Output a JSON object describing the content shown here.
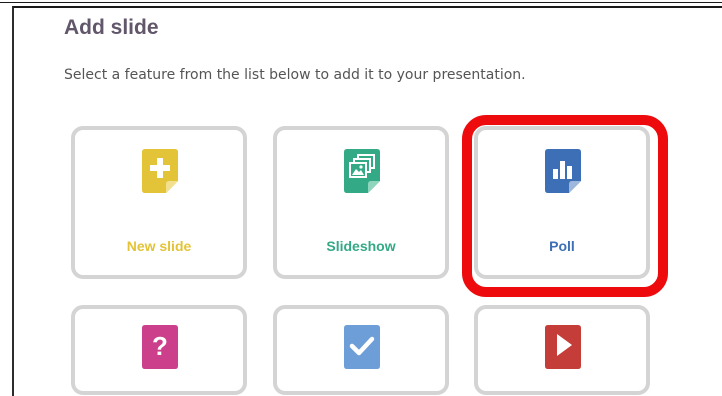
{
  "header": {
    "title": "Add slide",
    "subtitle": "Select a feature from the list below to add it to your presentation."
  },
  "features": [
    {
      "label": "New slide",
      "icon": "plus-document-icon",
      "color": "#e3c337"
    },
    {
      "label": "Slideshow",
      "icon": "image-stack-icon",
      "color": "#34a986"
    },
    {
      "label": "Poll",
      "icon": "bar-chart-icon",
      "color": "#3d6fb6"
    },
    {
      "label": "",
      "icon": "question-icon",
      "color": "#cc3f8b"
    },
    {
      "label": "",
      "icon": "checkmark-icon",
      "color": "#6d9ed8"
    },
    {
      "label": "",
      "icon": "play-icon",
      "color": "#c53d38"
    }
  ],
  "highlight": {
    "target": "Poll",
    "color": "#ed0b0e"
  }
}
